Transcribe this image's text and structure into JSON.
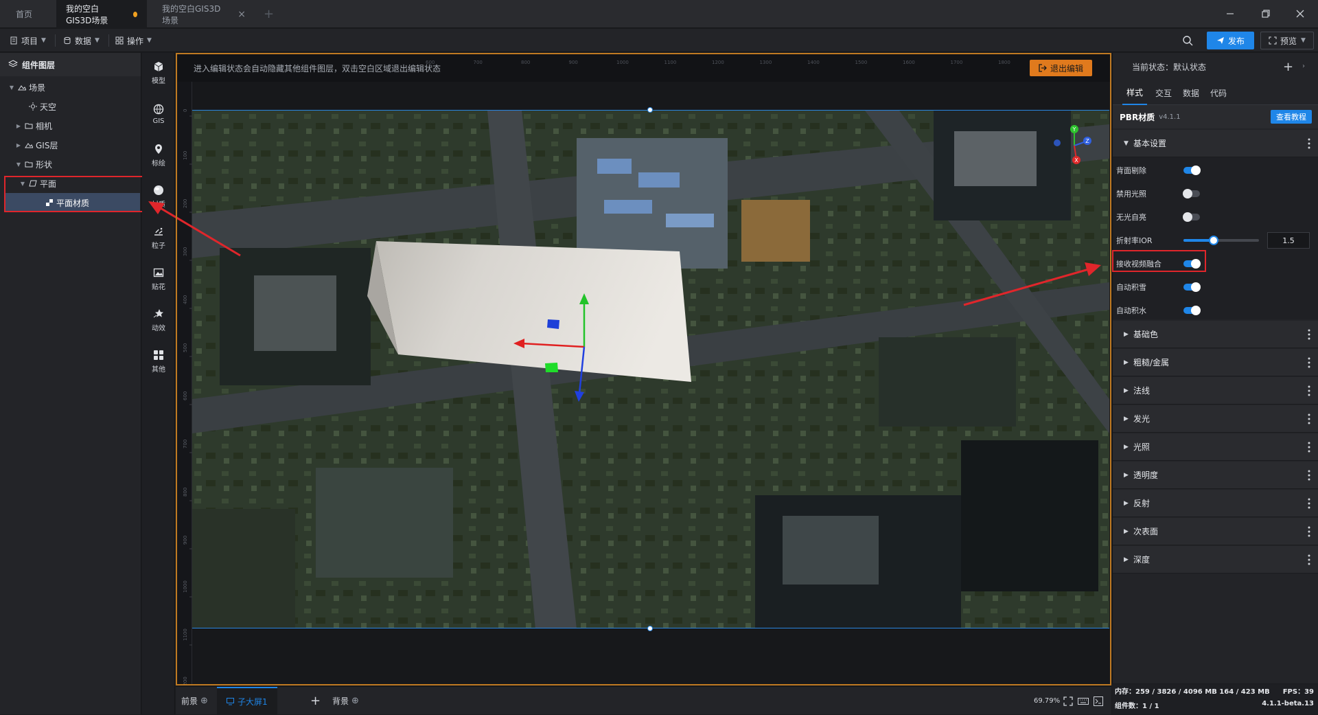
{
  "tabs": [
    {
      "label": "首页"
    },
    {
      "label": "我的空白GIS3D场景"
    },
    {
      "label": "我的空白GIS3D场景"
    }
  ],
  "toolbar": {
    "project": "项目",
    "data": "数据",
    "operate": "操作",
    "publish": "发布",
    "preview": "预览"
  },
  "layers": {
    "title": "组件图层",
    "items": [
      {
        "label": "场景"
      },
      {
        "label": "天空"
      },
      {
        "label": "相机"
      },
      {
        "label": "GIS层"
      },
      {
        "label": "形状"
      },
      {
        "label": "平面"
      },
      {
        "label": "平面材质"
      }
    ]
  },
  "components": [
    {
      "label": "模型",
      "icon": "model-icon"
    },
    {
      "label": "GIS",
      "icon": "globe-icon"
    },
    {
      "label": "标绘",
      "icon": "pin-icon"
    },
    {
      "label": "材质",
      "icon": "sphere-icon"
    },
    {
      "label": "粒子",
      "icon": "particle-icon"
    },
    {
      "label": "贴花",
      "icon": "image-icon"
    },
    {
      "label": "动效",
      "icon": "star-icon"
    },
    {
      "label": "其他",
      "icon": "grid-icon"
    }
  ],
  "canvas": {
    "hint": "进入编辑状态会自动隐藏其他组件图层，双击空白区域退出编辑状态",
    "exit_edit": "退出编辑",
    "axes": {
      "y": "Y",
      "z": "Z",
      "x": "X"
    },
    "ruler_top": [
      "600",
      "700",
      "800",
      "900",
      "1000",
      "1100",
      "1200",
      "1300",
      "1400",
      "1500",
      "1600",
      "1700",
      "1800"
    ],
    "ruler_left": [
      "0",
      "100",
      "200",
      "300",
      "400",
      "500",
      "600",
      "700",
      "800",
      "900",
      "1000",
      "1100",
      "1200"
    ]
  },
  "bottom": {
    "foreground": "前景",
    "sub_screen": "子大屏1",
    "background": "背景",
    "zoom": "69.79%"
  },
  "right": {
    "state_label": "当前状态：默认状态",
    "tabs": [
      "样式",
      "交互",
      "数据",
      "代码"
    ],
    "pbr_title": "PBR材质",
    "pbr_version": "v4.1.1",
    "tutorial": "查看教程",
    "basic_section": "基本设置",
    "props": [
      {
        "label": "背面剔除",
        "on": true
      },
      {
        "label": "禁用光照",
        "on": false
      },
      {
        "label": "无光自亮",
        "on": false
      },
      {
        "label": "折射率IOR"
      },
      {
        "label": "接收视频融合",
        "on": true
      },
      {
        "label": "自动积雪",
        "on": true
      },
      {
        "label": "自动积水",
        "on": true
      }
    ],
    "ior_value": "1.5",
    "ior_fraction": 0.4,
    "sections": [
      "基础色",
      "粗糙/金属",
      "法线",
      "发光",
      "光照",
      "透明度",
      "反射",
      "次表面",
      "深度"
    ]
  },
  "status": {
    "memory": "内存：259 / 3826 / 4096 MB  164 / 423 MB",
    "fps": "FPS：39",
    "components": "组件数：1 / 1",
    "version": "4.1.1-beta.13"
  },
  "colors": {
    "accent": "#1f86e8",
    "edit_frame": "#c07a22",
    "highlight": "#e0262b"
  }
}
